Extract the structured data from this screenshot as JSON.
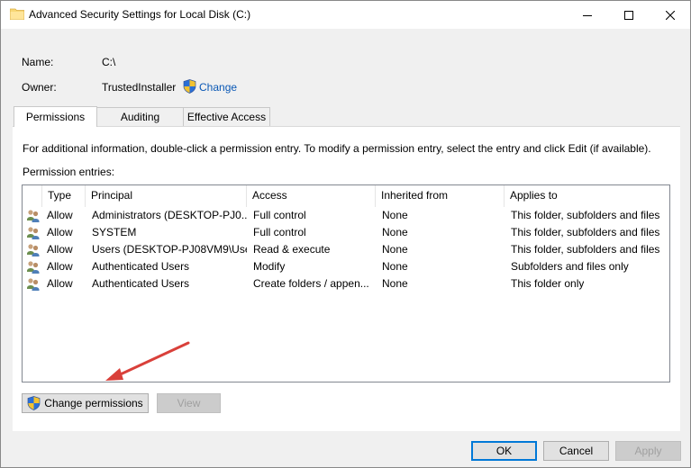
{
  "window": {
    "title": "Advanced Security Settings for Local Disk (C:)",
    "controls": [
      "minimize",
      "maximize",
      "close"
    ]
  },
  "info": {
    "name_label": "Name:",
    "name_value": "C:\\",
    "owner_label": "Owner:",
    "owner_value": "TrustedInstaller",
    "change_link": "Change"
  },
  "tabs": [
    {
      "label": "Permissions",
      "active": true
    },
    {
      "label": "Auditing",
      "active": false
    },
    {
      "label": "Effective Access",
      "active": false
    }
  ],
  "instructions": "For additional information, double-click a permission entry. To modify a permission entry, select the entry and click Edit (if available).",
  "entries_label": "Permission entries:",
  "columns": [
    "Type",
    "Principal",
    "Access",
    "Inherited from",
    "Applies to"
  ],
  "rows": [
    {
      "type": "Allow",
      "principal": "Administrators (DESKTOP-PJ0...",
      "access": "Full control",
      "inherited": "None",
      "applies": "This folder, subfolders and files"
    },
    {
      "type": "Allow",
      "principal": "SYSTEM",
      "access": "Full control",
      "inherited": "None",
      "applies": "This folder, subfolders and files"
    },
    {
      "type": "Allow",
      "principal": "Users (DESKTOP-PJ08VM9\\Use...",
      "access": "Read & execute",
      "inherited": "None",
      "applies": "This folder, subfolders and files"
    },
    {
      "type": "Allow",
      "principal": "Authenticated Users",
      "access": "Modify",
      "inherited": "None",
      "applies": "Subfolders and files only"
    },
    {
      "type": "Allow",
      "principal": "Authenticated Users",
      "access": "Create folders / appen...",
      "inherited": "None",
      "applies": "This folder only"
    }
  ],
  "buttons": {
    "change_permissions": "Change permissions",
    "view": "View",
    "ok": "OK",
    "cancel": "Cancel",
    "apply": "Apply"
  },
  "colors": {
    "link": "#0a58b5",
    "annotation_arrow": "#d9403a",
    "dialog_bg": "#f0f0f0",
    "accent": "#0078d7"
  },
  "icons": {
    "title": "folder-icon",
    "owner_change": "uac-shield-icon",
    "row": "users-icon",
    "change_permissions": "uac-shield-icon"
  }
}
